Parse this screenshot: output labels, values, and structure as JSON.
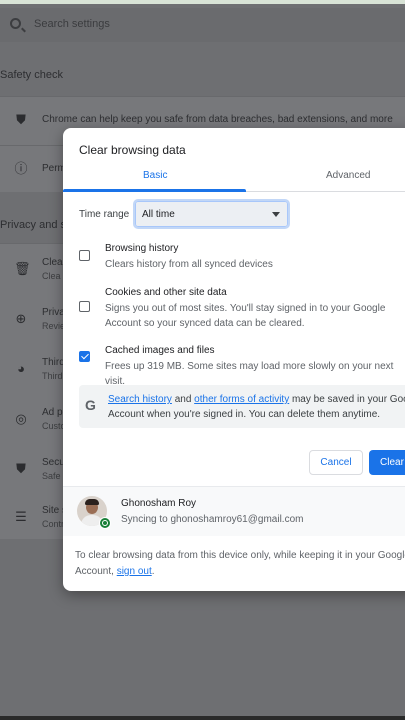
{
  "settings_page": {
    "search_placeholder": "Search settings",
    "safety_check_heading": "Safety check",
    "safety_check_row": "Chrome can help keep you safe from data breaches, bad extensions, and more",
    "permissions_row_partial": "Perm",
    "privacy_heading_partial": "Privacy and s",
    "rows": [
      {
        "title": "Clea",
        "sub": "Clea",
        "icon": "trash-icon"
      },
      {
        "title": "Priva",
        "sub": "Revie",
        "icon": "compass-icon"
      },
      {
        "title": "Third",
        "sub": "Third",
        "icon": "cookie-icon"
      },
      {
        "title": "Ad p",
        "sub": "Custo",
        "icon": "ad-privacy-icon"
      },
      {
        "title": "Secu",
        "sub": "Safe",
        "icon": "shield-icon"
      },
      {
        "title": "Site s",
        "sub": "Contr",
        "icon": "sliders-icon"
      }
    ]
  },
  "dialog": {
    "title": "Clear browsing data",
    "tabs": {
      "basic": "Basic",
      "advanced": "Advanced",
      "active": "Basic"
    },
    "time_range": {
      "label": "Time range",
      "value": "All time"
    },
    "options": [
      {
        "title": "Browsing history",
        "sub": "Clears history from all synced devices",
        "checked": false
      },
      {
        "title": "Cookies and other site data",
        "sub": "Signs you out of most sites. You'll stay signed in to your Google Account so your synced data can be cleared.",
        "checked": false
      },
      {
        "title": "Cached images and files",
        "sub": "Frees up 319 MB. Some sites may load more slowly on your next visit.",
        "checked": true
      }
    ],
    "info": {
      "link1": "Search history",
      "mid": " and ",
      "link2": "other forms of activity",
      "rest": " may be saved in your Google Account when you're signed in. You can delete them anytime."
    },
    "buttons": {
      "cancel": "Cancel",
      "clear": "Clear data"
    },
    "account": {
      "name": "Ghonosham Roy",
      "sync": "Syncing to ghonoshamroy61@gmail.com"
    },
    "footer": {
      "text": "To clear browsing data from this device only, while keeping it in your Google Account, ",
      "link": "sign out",
      "end": "."
    }
  },
  "colors": {
    "accent": "#1a73e8",
    "scrim": "#6e6f72"
  }
}
